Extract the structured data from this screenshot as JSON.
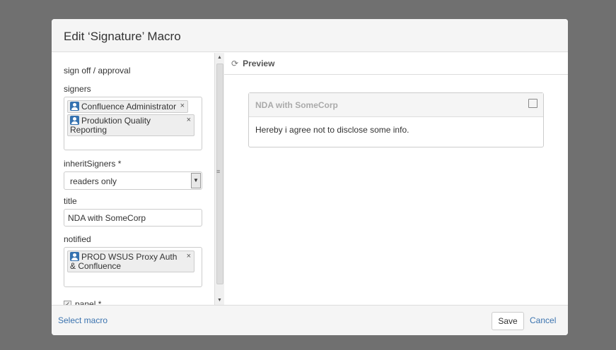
{
  "dialog": {
    "title": "Edit ‘Signature’ Macro"
  },
  "form": {
    "section": "sign off / approval",
    "signers_label": "signers",
    "signers": [
      "Confluence Administrator",
      "Produktion Quality Reporting"
    ],
    "inherit_label": "inheritSigners *",
    "inherit_value": "readers only",
    "title_label": "title",
    "title_value": "NDA with SomeCorp",
    "notified_label": "notified",
    "notified": [
      "PROD WSUS Proxy Auth & Confluence"
    ],
    "panel_label": "panel *",
    "panel_checked": true
  },
  "preview": {
    "label": "Preview",
    "card_title": "NDA with SomeCorp",
    "card_body": "Hereby i agree not to disclose some info."
  },
  "footer": {
    "select_macro": "Select macro",
    "save": "Save",
    "cancel": "Cancel"
  },
  "colors": {
    "link": "#3b73af",
    "avatar": "#3572b0"
  }
}
